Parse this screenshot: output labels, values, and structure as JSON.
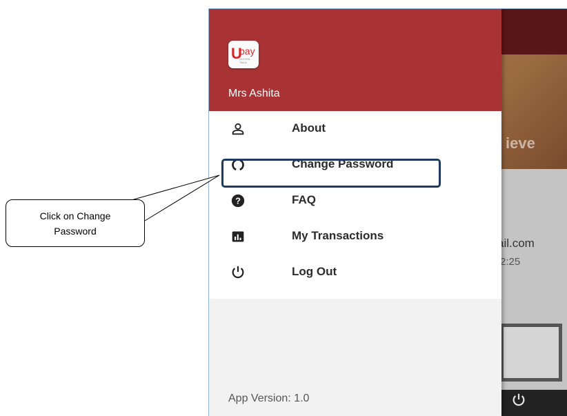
{
  "background_app": {
    "banner_partial_text": "ieve",
    "email_partial": "ail.com",
    "time_partial": "2:25"
  },
  "drawer": {
    "logo": {
      "brand": "Upay",
      "tagline": "DIGITAL TAKA"
    },
    "user_name": "Mrs Ashita",
    "menu_items": [
      {
        "label": "About",
        "icon": "person-icon"
      },
      {
        "label": "Change Password",
        "icon": "refresh-circle-icon"
      },
      {
        "label": "FAQ",
        "icon": "help-circle-icon"
      },
      {
        "label": "My Transactions",
        "icon": "bar-chart-icon"
      },
      {
        "label": "Log Out",
        "icon": "power-icon"
      }
    ],
    "app_version": "App Version: 1.0"
  },
  "annotation": {
    "callout_text": "Click on Change\nPassword",
    "highlighted_item": "Change Password"
  },
  "colors": {
    "header": "#a83234",
    "highlight_border": "#1e3a5f",
    "logo_red": "#d7262a"
  }
}
